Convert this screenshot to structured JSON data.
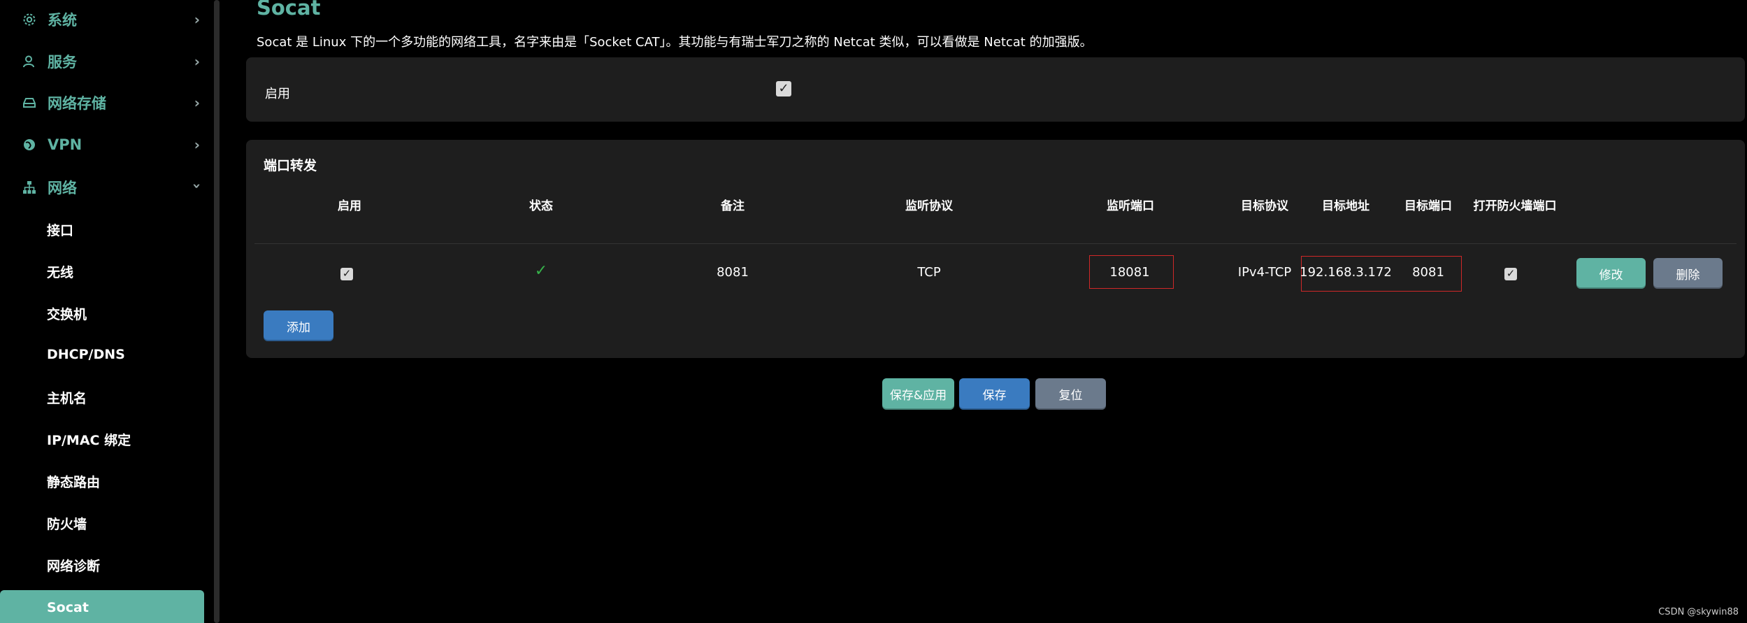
{
  "sidebar": {
    "top_items": [
      {
        "label": "系统",
        "icon": "gear-icon"
      },
      {
        "label": "服务",
        "icon": "user-service-icon"
      },
      {
        "label": "网络存储",
        "icon": "storage-drive-icon"
      },
      {
        "label": "VPN",
        "icon": "globe-icon"
      },
      {
        "label": "网络",
        "icon": "network-tree-icon"
      }
    ],
    "sub_items": [
      {
        "label": "接口"
      },
      {
        "label": "无线"
      },
      {
        "label": "交换机"
      },
      {
        "label": "DHCP/DNS"
      },
      {
        "label": "主机名"
      },
      {
        "label": "IP/MAC 绑定"
      },
      {
        "label": "静态路由"
      },
      {
        "label": "防火墙"
      },
      {
        "label": "网络诊断"
      },
      {
        "label": "Socat"
      }
    ],
    "active_item": "Socat"
  },
  "page": {
    "title": "Socat",
    "description": "Socat 是 Linux 下的一个多功能的网络工具，名字来由是「Socket CAT」。其功能与有瑞士军刀之称的 Netcat 类似，可以看做是 Netcat 的加强版。"
  },
  "enable_section": {
    "label": "启用",
    "checked": true
  },
  "port_forward": {
    "title": "端口转发",
    "columns": [
      "启用",
      "状态",
      "备注",
      "监听协议",
      "监听端口",
      "目标协议",
      "目标地址",
      "目标端口",
      "打开防火墙端口"
    ],
    "rows": [
      {
        "enabled": true,
        "status": "✓",
        "remark": "8081",
        "listen_protocol": "TCP",
        "listen_port": "18081",
        "target_protocol": "IPv4-TCP",
        "target_address": "192.168.3.172",
        "target_port": "8081",
        "open_firewall": true,
        "edit_label": "修改",
        "delete_label": "删除"
      }
    ],
    "add_label": "添加"
  },
  "actions": {
    "save_apply_label": "保存&应用",
    "save_label": "保存",
    "reset_label": "复位"
  },
  "watermark": "CSDN @skywin88",
  "colors": {
    "accent": "#5fb3a3",
    "primary_button": "#3a7bc0",
    "secondary_button": "#6b7a8c",
    "panel_bg": "#1e1e1e",
    "highlight": "#d02828",
    "status_ok": "#36b24a"
  }
}
